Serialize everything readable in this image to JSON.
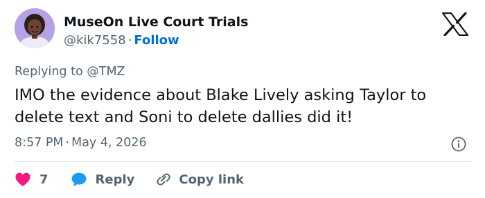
{
  "author": {
    "display_name": "MuseOn Live Court Trials",
    "handle": "@kik7558",
    "separator": "·",
    "follow_label": "Follow",
    "avatar_icon": "cartoon-woman-avatar"
  },
  "brand": {
    "logo_icon": "x-logo-icon"
  },
  "tweet": {
    "replying_to_prefix": "Replying to",
    "replying_to_handle": "@TMZ",
    "text": "IMO the evidence about Blake Lively asking Taylor to delete text and Soni to delete dallies did it!",
    "time": "8:57 PM",
    "separator": "·",
    "date": "May 4, 2026"
  },
  "actions": {
    "like_count": "7",
    "reply_label": "Reply",
    "copy_link_label": "Copy link"
  },
  "colors": {
    "like_heart": "#f91880",
    "reply_bubble": "#1d9bf0",
    "follow_link": "#006fd6",
    "secondary_text": "#536471",
    "divider": "#cfd9de"
  }
}
